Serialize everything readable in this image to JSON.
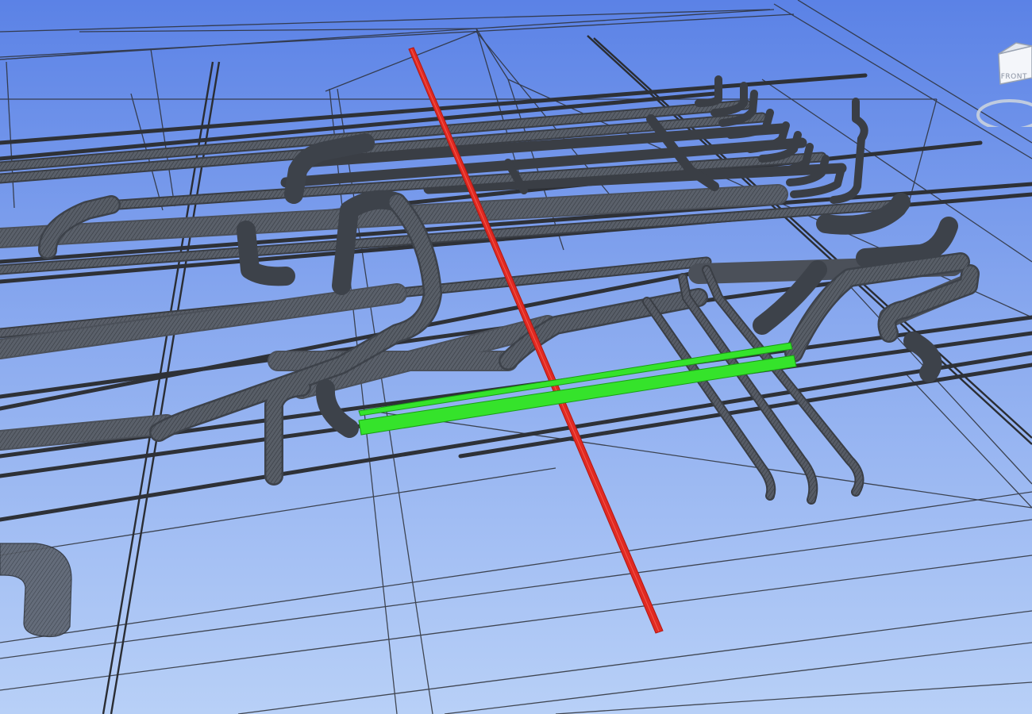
{
  "viewcube": {
    "face_label": "FRONT",
    "colors": {
      "face": "#f4f6fa",
      "edge": "#9aa3b2",
      "ring": "#c9d1de"
    }
  },
  "colors": {
    "background_top": "#5b82e6",
    "background_bottom": "#b8d0f7",
    "pipe": "#4a4f58",
    "pipe_edge": "#2a2d33",
    "grid_line": "#2c2f36",
    "clash_element": "#e02a22",
    "selected_element": "#35e32b"
  },
  "icons": [
    "viewcube-icon",
    "orbit-ring-icon"
  ]
}
